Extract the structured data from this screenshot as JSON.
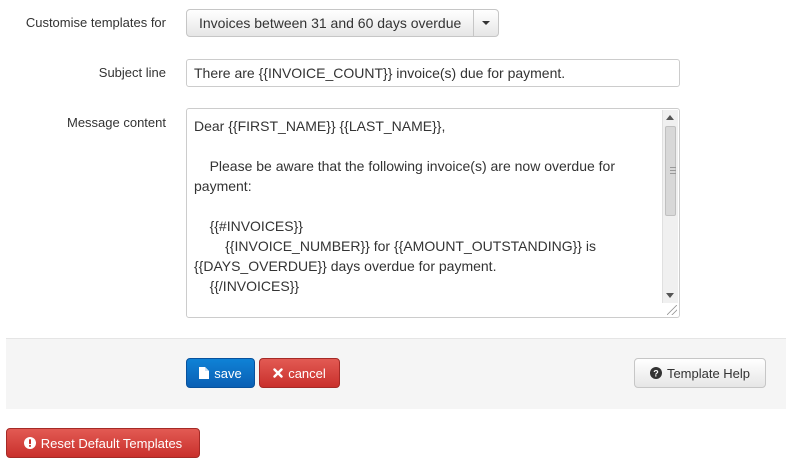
{
  "form": {
    "template_for_label": "Customise templates for",
    "template_for_value": "Invoices between 31 and 60 days overdue",
    "subject_label": "Subject line",
    "subject_value": "There are {{INVOICE_COUNT}} invoice(s) due for payment.",
    "message_label": "Message content",
    "message_value": "Dear {{FIRST_NAME}} {{LAST_NAME}},\n\n    Please be aware that the following invoice(s) are now overdue for payment:\n\n    {{#INVOICES}}\n        {{INVOICE_NUMBER}} for {{AMOUNT_OUTSTANDING}} is {{DAYS_OVERDUE}} days overdue for payment.\n    {{/INVOICES}}"
  },
  "actions": {
    "save_label": "save",
    "cancel_label": "cancel",
    "help_label": "Template Help",
    "reset_label": "Reset Default Templates"
  },
  "icons": {
    "save": "file-icon",
    "cancel": "times-icon",
    "help": "question-circle-icon",
    "reset": "exclamation-circle-icon"
  },
  "colors": {
    "primary": "#0a6fc2",
    "danger": "#d2322d",
    "bar_background": "#f5f5f5"
  }
}
